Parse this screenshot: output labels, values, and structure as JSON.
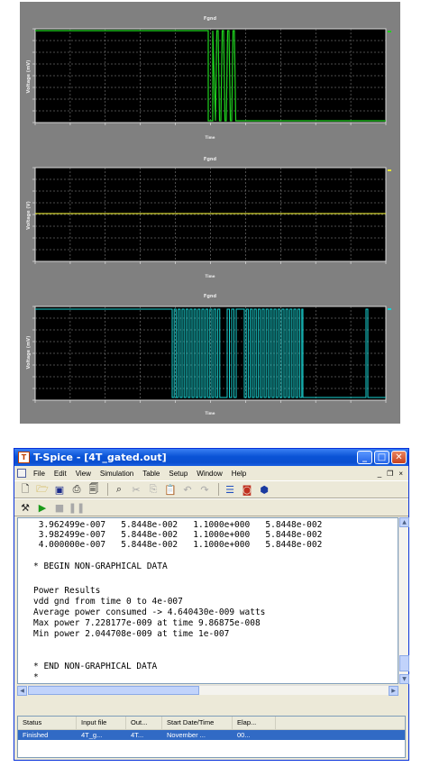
{
  "viewer": {
    "panels": [
      {
        "title": "Fgnd",
        "ylabel": "Voltage (mV)",
        "xlabel": "Time",
        "trace_color": "#1fd31f"
      },
      {
        "title": "Fgnd",
        "ylabel": "Voltage (V)",
        "xlabel": "Time",
        "trace_color": "#e6e633"
      },
      {
        "title": "Fgnd",
        "ylabel": "Voltage (mV)",
        "xlabel": "Time",
        "trace_color": "#19d3d3"
      }
    ]
  },
  "window": {
    "title": "T-Spice - [4T_gated.out]",
    "app_icon": "tspice-app-icon",
    "caption_buttons": {
      "minimize": "_",
      "maximize": "□",
      "close": "✕"
    },
    "menu": [
      "File",
      "Edit",
      "View",
      "Simulation",
      "Table",
      "Setup",
      "Window",
      "Help"
    ],
    "mdi_buttons": {
      "minimize": "_",
      "restore": "❐",
      "close": "×"
    },
    "toolbar1_icons": [
      "new-document-icon",
      "open-folder-icon",
      "save-icon",
      "print-icon",
      "print-preview-icon",
      "find-icon",
      "cut-icon",
      "copy-icon",
      "paste-icon",
      "undo-icon",
      "redo-icon",
      "simulation-settings-icon",
      "waveform-viewer-icon",
      "run-icon"
    ],
    "toolbar2_icons": [
      "tools-icon",
      "play-icon",
      "stop-icon",
      "pause-icon"
    ],
    "accent": "#0a53d6"
  },
  "output": {
    "lines": [
      " 3.962499e-007   5.8448e-002   1.1000e+000   5.8448e-002",
      " 3.982499e-007   5.8448e-002   1.1000e+000   5.8448e-002",
      " 4.000000e-007   5.8448e-002   1.1000e+000   5.8448e-002",
      "",
      "* BEGIN NON-GRAPHICAL DATA",
      "",
      "Power Results",
      "vdd gnd from time 0 to 4e-007",
      "Average power consumed -> 4.640430e-009 watts",
      "Max power 7.228177e-009 at time 9.86875e-008",
      "Min power 2.044708e-009 at time 1e-007",
      "",
      "",
      "* END NON-GRAPHICAL DATA",
      "*"
    ]
  },
  "status_list": {
    "columns": [
      "Status",
      "Input file",
      "Out...",
      "Start Date/Time",
      "Elap..."
    ],
    "rows": [
      {
        "status": "Finished",
        "input_file": "4T_g...",
        "output": "4T...",
        "start": "November ...",
        "elapsed": "00..."
      }
    ]
  }
}
